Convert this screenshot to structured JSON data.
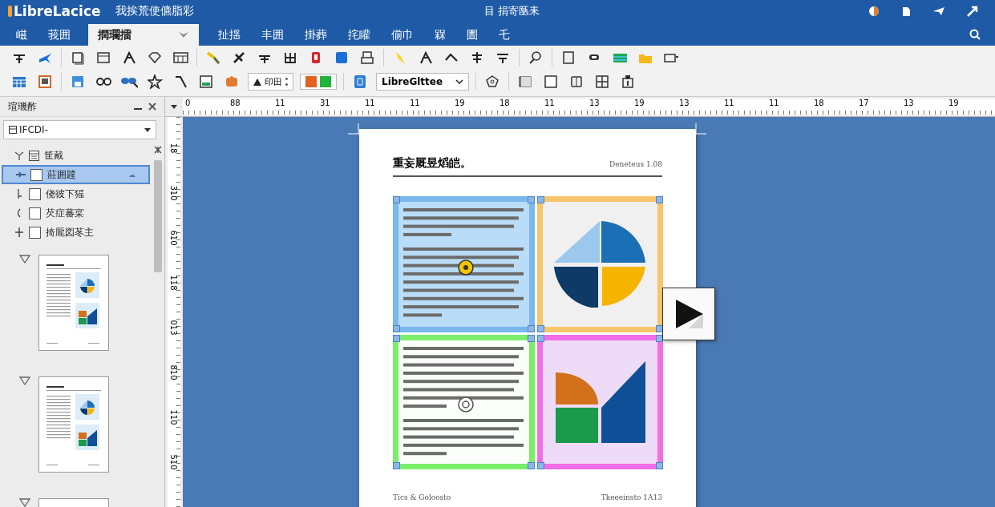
{
  "window": {
    "app_name": "LibreLacice",
    "subtitle": "我挨荒使儦脂彩",
    "title": "目 捐寄匦耒"
  },
  "menu": [
    {
      "label": "嵫",
      "selected": false
    },
    {
      "label": "莪囲",
      "selected": false
    },
    {
      "label": "撋瓓擂",
      "selected": true
    },
    {
      "label": "扯揺",
      "selected": false
    },
    {
      "label": "丰囲",
      "selected": false
    },
    {
      "label": "掛葬",
      "selected": false
    },
    {
      "label": "挓矔",
      "selected": false
    },
    {
      "label": "偂巾",
      "selected": false
    },
    {
      "label": "槑",
      "selected": false
    },
    {
      "label": "圕",
      "selected": false
    },
    {
      "label": "乇",
      "selected": false
    }
  ],
  "toolbar": {
    "style_box": "印田",
    "font_name": "LibreGlttee"
  },
  "ruler": {
    "horizontal": [
      "0",
      "88",
      "11",
      "31",
      "11",
      "11",
      "19",
      "18",
      "11",
      "13",
      "19",
      "13",
      "11",
      "11",
      "18",
      "17",
      "13",
      "19"
    ],
    "vertical": [
      "18",
      "310",
      "610",
      "118",
      "013",
      "810",
      "110",
      "510"
    ]
  },
  "sidebar": {
    "title": "瑄璣酢",
    "dropdown": "IFCDI-",
    "items": [
      {
        "label": "筐戴",
        "kind": "header",
        "selected": false
      },
      {
        "label": "莊囲韙",
        "kind": "checkbox",
        "checked": false,
        "selected": true
      },
      {
        "label": "侥彼下猺",
        "kind": "checkbox",
        "checked": false,
        "selected": false
      },
      {
        "label": "芡症蕃寀",
        "kind": "checkbox",
        "checked": false,
        "selected": false
      },
      {
        "label": "掎龎図苳主",
        "kind": "checkbox",
        "checked": false,
        "selected": false
      }
    ],
    "pages": [
      {
        "expanded": true
      },
      {
        "expanded": true
      },
      {
        "expanded": true
      }
    ]
  },
  "document": {
    "heading": "重妄厩昱熖皑。",
    "header_right": "Deneteus 1.08",
    "footer_left": "Tics & Goloosto",
    "footer_right": "Tkeeeinsto 1A13",
    "frames": [
      {
        "kind": "text",
        "color": "#7ab8ee"
      },
      {
        "kind": "pie",
        "color": "#f9c56a"
      },
      {
        "kind": "text",
        "color": "#7aed6a"
      },
      {
        "kind": "shapes",
        "color": "#f26ee6"
      }
    ]
  }
}
